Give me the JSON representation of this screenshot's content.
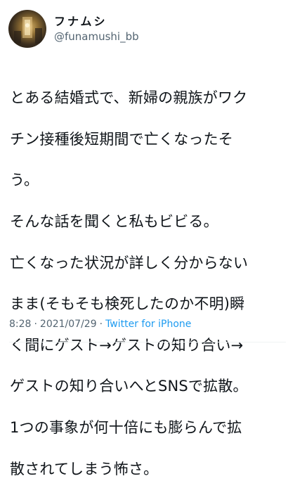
{
  "user": {
    "display_name": "フナムシ",
    "handle": "@funamushi_bb"
  },
  "tweet": {
    "text": "とある結婚式で、新婦の親族がワクチン接種後短期間で亡くなったそう。\nそんな話を聞くと私もビビる。\n亡くなった状況が詳しく分からないまま(そもそも検死したのか不明)瞬く間にゲスト→ゲストの知り合い→ゲストの知り合いへとSNSで拡散。\n1つの事象が何十倍にも膨らんで拡散されてしまう怖さ。",
    "lines": [
      "とある結婚式で、新婦の親族がワク",
      "チン接種後短期間で亡くなったそ",
      "う。",
      "そんな話を聞くと私もビビる。",
      "亡くなった状況が詳しく分からない",
      "まま(そもそも検死したのか不明)瞬",
      "く間にゲスト→ゲストの知り合い→",
      "ゲストの知り合いへとSNSで拡散。",
      "1つの事象が何十倍にも膨らんで拡",
      "散されてしまう怖さ。"
    ]
  },
  "meta": {
    "time": "8:28",
    "date": "2021/07/29",
    "separator": "·",
    "source": "Twitter for iPhone"
  },
  "colors": {
    "text": "#0f1419",
    "secondary": "#536471",
    "link": "#1d9bf0"
  }
}
